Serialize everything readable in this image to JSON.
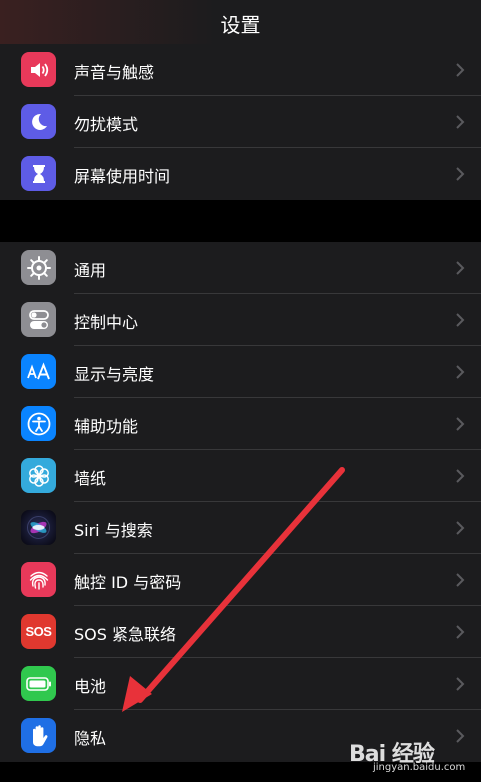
{
  "header": {
    "title": "设置"
  },
  "group1": {
    "items": [
      {
        "label": "声音与触感",
        "icon": "speaker-icon",
        "color": "#e8395a"
      },
      {
        "label": "勿扰模式",
        "icon": "moon-icon",
        "color": "#5e5ce6"
      },
      {
        "label": "屏幕使用时间",
        "icon": "hourglass-icon",
        "color": "#5e5ce6"
      }
    ]
  },
  "group2": {
    "items": [
      {
        "label": "通用",
        "icon": "gear-icon",
        "color": "#8e8e93"
      },
      {
        "label": "控制中心",
        "icon": "toggles-icon",
        "color": "#8e8e93"
      },
      {
        "label": "显示与亮度",
        "icon": "text-size-icon",
        "color": "#0a84ff"
      },
      {
        "label": "辅助功能",
        "icon": "accessibility-icon",
        "color": "#0a84ff"
      },
      {
        "label": "墙纸",
        "icon": "flower-icon",
        "color": "#34aadc"
      },
      {
        "label": "Siri 与搜索",
        "icon": "siri-icon",
        "color": "#1c1c1e"
      },
      {
        "label": "触控 ID 与密码",
        "icon": "fingerprint-icon",
        "color": "#e8395a"
      },
      {
        "label": "SOS 紧急联络",
        "icon": "sos-icon",
        "color": "#e0382f",
        "icon_text": "SOS"
      },
      {
        "label": "电池",
        "icon": "battery-icon",
        "color": "#30c84e"
      },
      {
        "label": "隐私",
        "icon": "hand-icon",
        "color": "#1f6fe5"
      }
    ]
  },
  "watermark": {
    "brand": "Bai 经验",
    "url": "jingyan.baidu.com"
  },
  "colors": {
    "background": "#000000",
    "cell": "#1c1c1e",
    "separator": "#38383a",
    "chevron": "#5a5a5e",
    "annotation_arrow": "#e8323a"
  }
}
